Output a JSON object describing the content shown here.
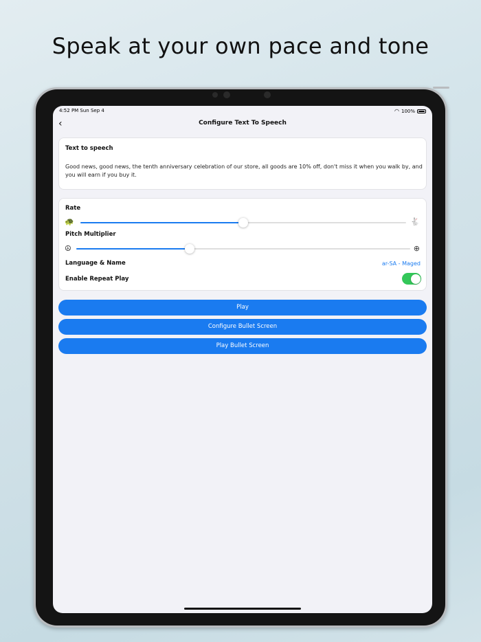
{
  "headline": "Speak at your own pace and tone",
  "status_bar": {
    "time": "4:52 PM   Sun Sep 4",
    "battery": "100%"
  },
  "nav": {
    "title": "Configure Text To Speech"
  },
  "text_card": {
    "label": "Text to speech",
    "text": "Good news, good news, the tenth anniversary celebration of our store, all goods are 10% off, don't miss it when you walk by, and you will earn if you buy it."
  },
  "settings": {
    "rate_label": "Rate",
    "rate_value": 0.5,
    "pitch_label": "Pitch Multiplier",
    "pitch_value": 0.34,
    "language_label": "Language & Name",
    "language_value": "ar-SA - Maged",
    "repeat_label": "Enable Repeat Play",
    "repeat_enabled": true
  },
  "buttons": {
    "play": "Play",
    "configure_bullet": "Configure Bullet Screen",
    "play_bullet": "Play Bullet Screen"
  },
  "colors": {
    "accent": "#1a7bf0",
    "toggle_on": "#33c759"
  },
  "icons": [
    "back-chevron-icon",
    "wifi-icon",
    "battery-icon",
    "turtle-icon",
    "rabbit-icon",
    "peace-icon",
    "crosshair-plus-icon"
  ]
}
